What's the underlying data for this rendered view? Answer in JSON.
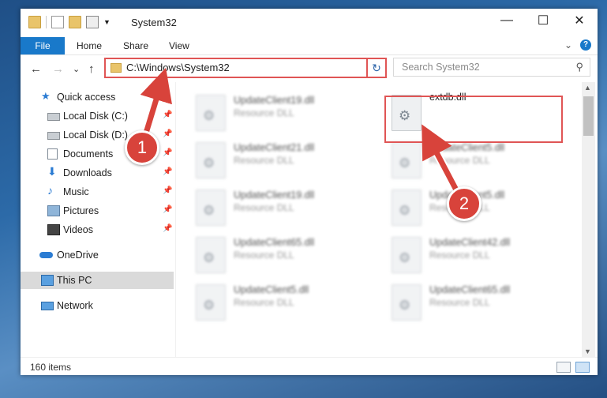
{
  "window": {
    "title": "System32",
    "controls": {
      "minimize": "—",
      "maximize": "☐",
      "close": "✕"
    }
  },
  "ribbon": {
    "file_label": "File",
    "tabs": [
      {
        "label": "Home"
      },
      {
        "label": "Share"
      },
      {
        "label": "View"
      }
    ],
    "expand_glyph": "⌄",
    "help_glyph": "?"
  },
  "nav": {
    "back": "←",
    "forward": "→",
    "recent": "⌄",
    "up": "↑",
    "address": "C:\\Windows\\System32",
    "address_dropdown": "⌄",
    "refresh": "↻",
    "search_placeholder": "Search System32",
    "search_icon": "⚲"
  },
  "sidebar": {
    "items": [
      {
        "label": "Quick access",
        "icon": "star-icon",
        "pinned": false
      },
      {
        "label": "Local Disk (C:)",
        "icon": "drive-icon",
        "pinned": true
      },
      {
        "label": "Local Disk (D:)",
        "icon": "drive-icon",
        "pinned": true
      },
      {
        "label": "Documents",
        "icon": "documents-icon",
        "pinned": true
      },
      {
        "label": "Downloads",
        "icon": "download-icon",
        "pinned": true
      },
      {
        "label": "Music",
        "icon": "music-icon",
        "pinned": true
      },
      {
        "label": "Pictures",
        "icon": "pictures-icon",
        "pinned": true
      },
      {
        "label": "Videos",
        "icon": "videos-icon",
        "pinned": true
      },
      {
        "label": "OneDrive",
        "icon": "cloud-icon",
        "pinned": false
      },
      {
        "label": "This PC",
        "icon": "pc-icon",
        "pinned": false,
        "selected": true
      },
      {
        "label": "Network",
        "icon": "network-icon",
        "pinned": false
      }
    ],
    "pin_glyph": "📌"
  },
  "files": [
    {
      "name": "UpdateClient19.dll",
      "type": "Resource DLL"
    },
    {
      "name": "extdb.dll",
      "type": ""
    },
    {
      "name": "UpdateClient21.dll",
      "type": "Resource DLL"
    },
    {
      "name": "UpdateClient5.dll",
      "type": "Resource DLL"
    },
    {
      "name": "UpdateClient19.dll",
      "type": "Resource DLL"
    },
    {
      "name": "UpdateClient5.dll",
      "type": "Resource DLL"
    },
    {
      "name": "UpdateClient65.dll",
      "type": "Resource DLL"
    },
    {
      "name": "UpdateClient42.dll",
      "type": "Resource DLL"
    },
    {
      "name": "UpdateClient5.dll",
      "type": "Resource DLL"
    },
    {
      "name": "UpdateClient65.dll",
      "type": "Resource DLL"
    }
  ],
  "status": {
    "item_count": "160 items"
  },
  "annotations": {
    "badge1": "1",
    "badge2": "2"
  },
  "colors": {
    "accent": "#1979ca",
    "highlight": "#e05555",
    "badge": "#d8433b"
  }
}
